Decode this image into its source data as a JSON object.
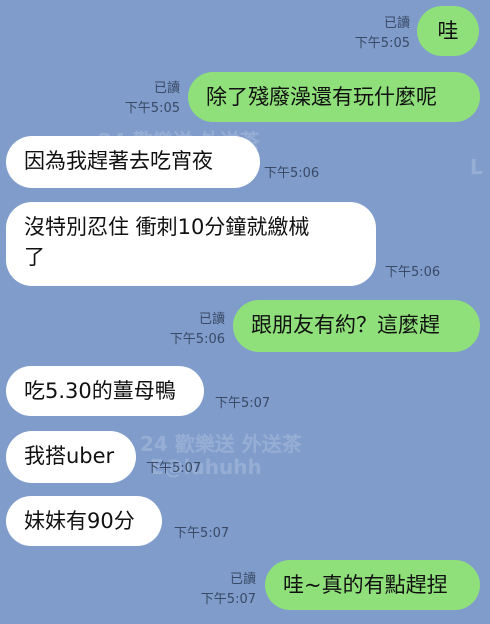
{
  "messages": [
    {
      "text": "哇",
      "read": "已讀",
      "time": "下午5:05"
    },
    {
      "text": "除了殘廢澡還有玩什麼呢",
      "read": "已讀",
      "time": "下午5:05"
    },
    {
      "text": "因為我趕著去吃宵夜",
      "time": "下午5:06"
    },
    {
      "text": "沒特別忍住 衝刺10分鐘就繳械",
      "text2": "了",
      "time": "下午5:06"
    },
    {
      "text": "跟朋友有約？這麼趕",
      "read": "已讀",
      "time": "下午5:06"
    },
    {
      "text": "吃5.30的薑母鴨",
      "time": "下午5:07"
    },
    {
      "text": "我搭uber",
      "time": "下午5:07"
    },
    {
      "text": "妹妹有90分",
      "time": "下午5:07"
    },
    {
      "text": "哇~真的有點趕捏",
      "read": "已讀",
      "time": "下午5:07"
    }
  ],
  "watermark": {
    "line1": "24 歡樂送 外送茶",
    "line2": "L",
    "line3": "24 歡樂送 外送茶",
    "line4": "E@luhuhh"
  }
}
